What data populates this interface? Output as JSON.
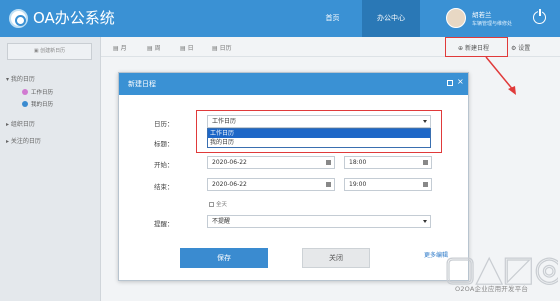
{
  "app": {
    "title": "OA办公系统"
  },
  "topnav": {
    "home": "首页",
    "office": "办公中心"
  },
  "user": {
    "name": "胡若兰",
    "dept": "车辆管理与维修处"
  },
  "sidebar": {
    "create_label": "创建新日历",
    "my_calendar": "我的日历",
    "sub_items": [
      {
        "label": "工作日历",
        "color": "#d17ad1"
      },
      {
        "label": "我的日历",
        "color": "#3a8bd0"
      }
    ],
    "org_calendar": "组织日历",
    "followed_calendar": "关注的日历"
  },
  "view_tabs": {
    "month": "月",
    "week": "周",
    "day": "日",
    "calendar": "日历"
  },
  "actions": {
    "new_schedule": "新建日程",
    "settings": "设置"
  },
  "modal": {
    "title": "新建日程",
    "calendar_label": "日历：",
    "calendar_value": "工作日历",
    "calendar_options": [
      "工作日历",
      "我的日历"
    ],
    "subject_label": "标题：",
    "start_label": "开始：",
    "start_date": "2020-06-22",
    "start_time": "18:00",
    "end_label": "结束：",
    "end_date": "2020-06-22",
    "end_time": "19:00",
    "allday_label": "全天",
    "remind_label": "提醒：",
    "remind_value": "不提醒",
    "save_label": "保存",
    "close_label": "关闭",
    "more_label": "更多编辑"
  },
  "watermark": {
    "text": "O2OA企业应用开发平台"
  },
  "colors": {
    "accent": "#3a91d4",
    "highlight": "#e03a3a"
  }
}
